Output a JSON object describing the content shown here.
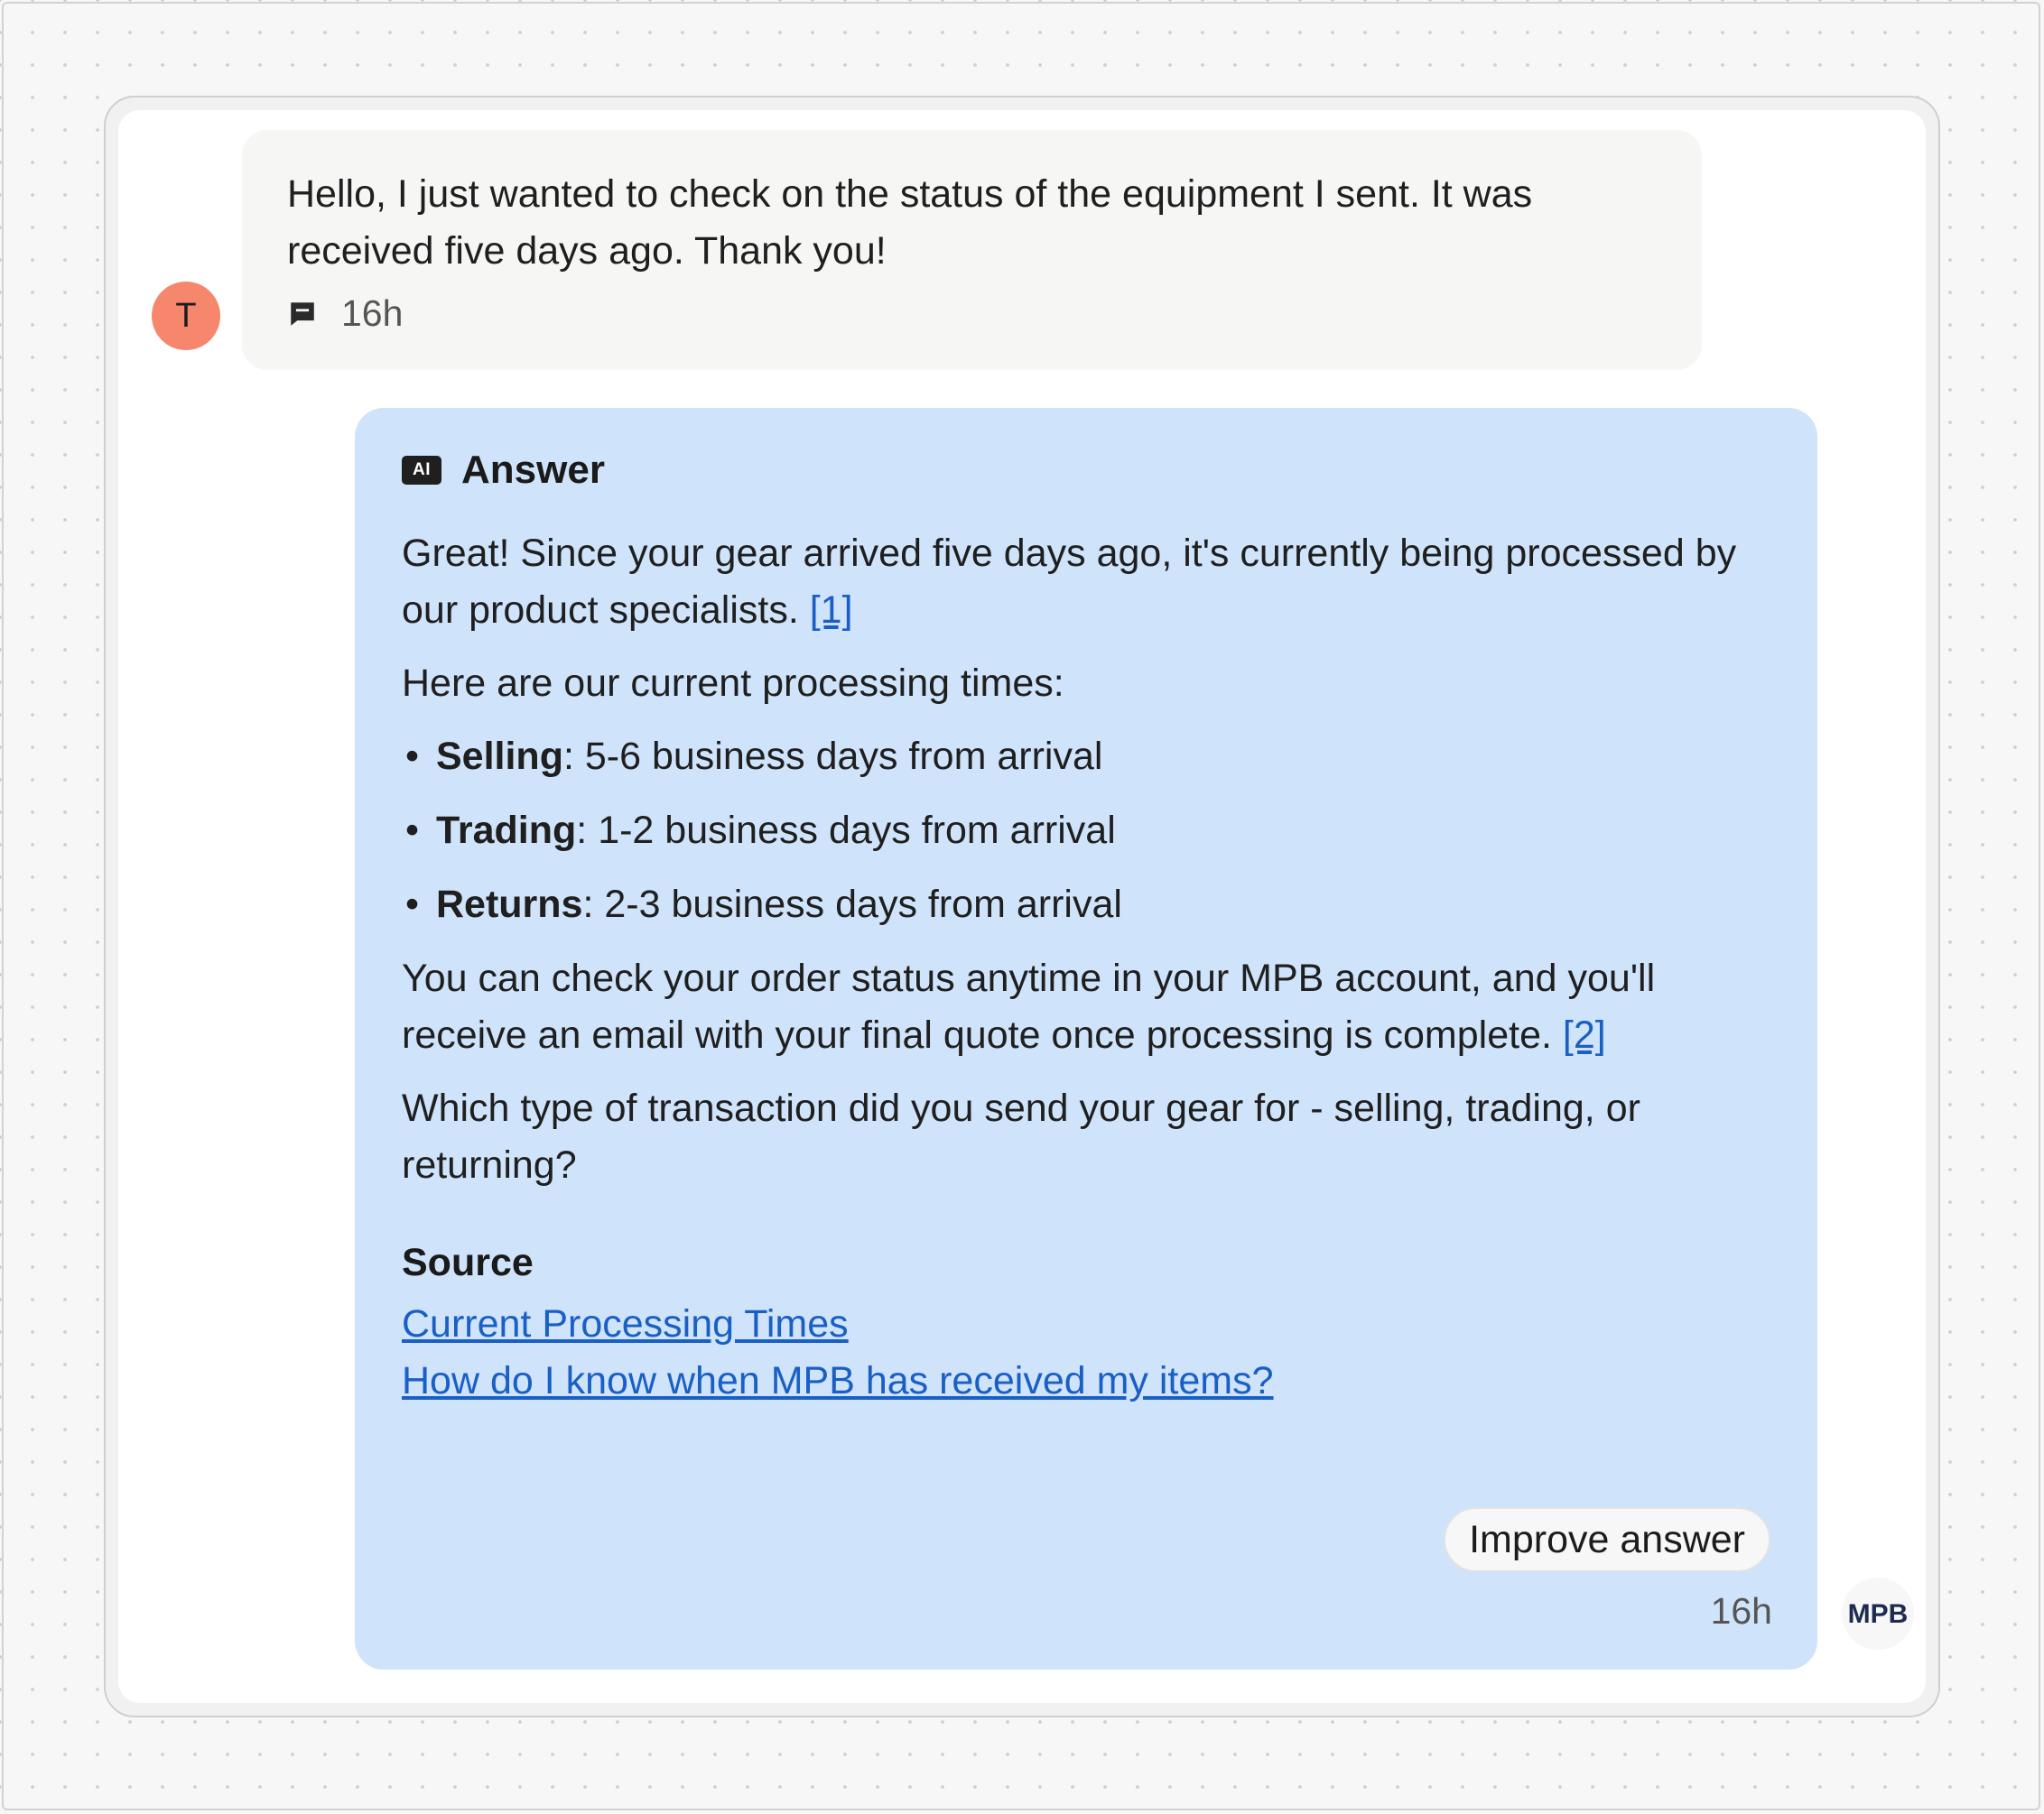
{
  "user_message": {
    "avatar_initial": "T",
    "text": "Hello, I just wanted to check on the status of the equipment I sent. It was received five days ago. Thank you!",
    "time": "16h",
    "icon": "chat-bubble-icon"
  },
  "ai_answer": {
    "badge": "AI",
    "title": "Answer",
    "para1": "Great! Since your gear arrived five days ago, it's currently being processed by our product specialists.",
    "cite1": "[1]",
    "para2": "Here are our current processing times:",
    "bullets": [
      {
        "label": "Selling",
        "text": ": 5-6 business days from arrival"
      },
      {
        "label": "Trading",
        "text": ": 1-2 business days from arrival"
      },
      {
        "label": "Returns",
        "text": ": 2-3 business days from arrival"
      }
    ],
    "para3": "You can check your order status anytime in your MPB account, and you'll receive an email with your final quote once processing is complete.",
    "cite2": "[2]",
    "para4": "Which type of transaction did you send your gear for - selling, trading, or returning?",
    "source_title": "Source",
    "sources": [
      "Current Processing Times",
      "How do I know when MPB has received my items?"
    ],
    "improve_button": "Improve answer",
    "time": "16h",
    "bot_logo": "MPB"
  },
  "colors": {
    "ai_bubble_bg": "#cfe3fa",
    "user_bubble_bg": "#f6f6f5",
    "avatar_bg": "#f6876d",
    "link": "#1a5fc4",
    "logo": "#1e2a4f"
  }
}
